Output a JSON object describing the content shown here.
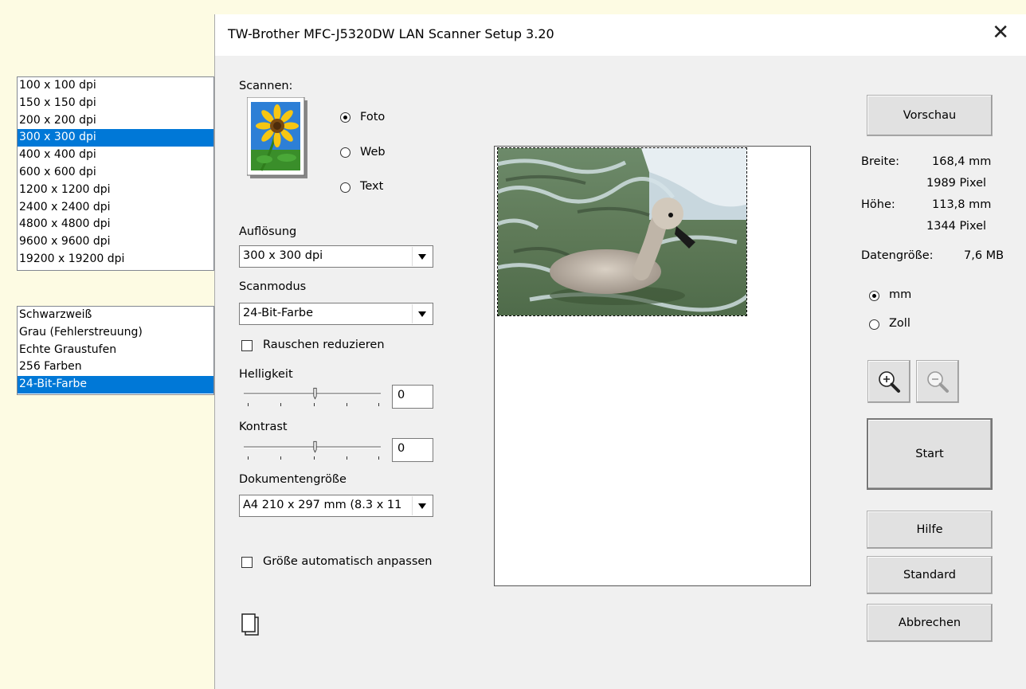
{
  "resolution_list": {
    "items": [
      "100 x 100 dpi",
      "150 x 150 dpi",
      "200 x 200 dpi",
      "300 x 300 dpi",
      "400 x 400 dpi",
      "600 x 600 dpi",
      "1200 x 1200 dpi",
      "2400 x 2400 dpi",
      "4800 x 4800 dpi",
      "9600 x 9600 dpi",
      "19200 x 19200 dpi"
    ],
    "selected_index": 3
  },
  "mode_list": {
    "items": [
      "Schwarzweiß",
      "Grau (Fehlerstreuung)",
      "Echte Graustufen",
      "256 Farben",
      "24-Bit-Farbe"
    ],
    "selected_index": 4
  },
  "dialog": {
    "title": "TW-Brother MFC-J5320DW LAN Scanner Setup 3.20",
    "close_glyph": "✕"
  },
  "scan": {
    "label": "Scannen:",
    "options": [
      "Foto",
      "Web",
      "Text"
    ],
    "selected": "Foto"
  },
  "resolution": {
    "label": "Auflösung",
    "value": "300 x 300 dpi"
  },
  "scanmode": {
    "label": "Scanmodus",
    "value": "24-Bit-Farbe"
  },
  "noise": {
    "label": "Rauschen reduzieren",
    "checked": false
  },
  "brightness": {
    "label": "Helligkeit",
    "value": "0"
  },
  "contrast": {
    "label": "Kontrast",
    "value": "0"
  },
  "docsize": {
    "label": "Dokumentengröße",
    "value": "A4 210 x 297 mm (8.3 x 11"
  },
  "autosize": {
    "label": "Größe automatisch anpassen",
    "checked": false
  },
  "buttons": {
    "preview": "Vorschau",
    "start": "Start",
    "help": "Hilfe",
    "standard": "Standard",
    "cancel": "Abbrechen"
  },
  "info": {
    "width_label": "Breite:",
    "width_mm": "168,4 mm",
    "width_px": "1989 Pixel",
    "height_label": "Höhe:",
    "height_mm": "113,8 mm",
    "height_px": "1344 Pixel",
    "datasize_label": "Datengröße:",
    "datasize_value": "7,6 MB"
  },
  "units": {
    "options": [
      "mm",
      "Zoll"
    ],
    "selected": "mm"
  },
  "icons": [
    "sunflower-photo-icon",
    "zoom-in-icon",
    "zoom-out-icon",
    "copy-pages-icon",
    "close-icon"
  ]
}
